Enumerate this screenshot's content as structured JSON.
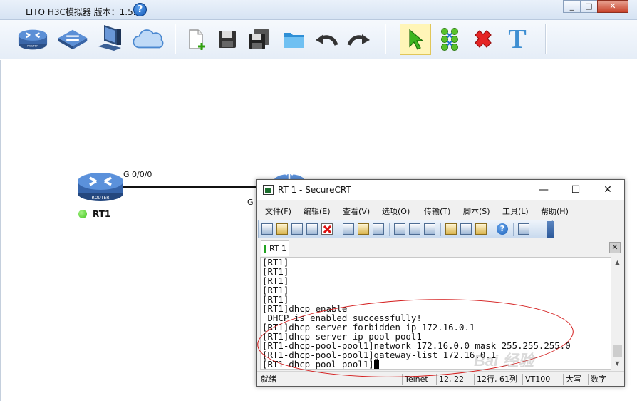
{
  "app": {
    "title": "LITO H3C模拟器 版本：1.5.2",
    "help_icon": "?",
    "window_controls": [
      "_",
      "□",
      "✕"
    ]
  },
  "toolbar": {
    "items": [
      "router-icon",
      "switch-icon",
      "pc-icon",
      "cloud-icon",
      "new-file-icon",
      "save-icon",
      "save-as-icon",
      "open-folder-icon",
      "undo-icon",
      "redo-icon",
      "select-pointer-icon",
      "link-tool-icon",
      "delete-icon",
      "text-tool-icon"
    ],
    "text_tool_label": "T",
    "active_item": "select-pointer-icon"
  },
  "topology": {
    "router1": {
      "name": "RT1",
      "badge": "ROUTER",
      "port": "G 0/0/0",
      "status_color": "#3ec11a"
    },
    "router2": {
      "port_label_partial": "G"
    }
  },
  "crt": {
    "title": "RT 1 - SecureCRT",
    "controls": [
      "—",
      "☐",
      "✕"
    ],
    "menu": [
      "文件(F)",
      "编辑(E)",
      "查看(V)",
      "选项(O)",
      "传输(T)",
      "脚本(S)",
      "工具(L)",
      "帮助(H)"
    ],
    "tab": {
      "label": "RT 1",
      "close": "✕"
    },
    "terminal_lines": [
      "[RT1]",
      "[RT1]",
      "[RT1]",
      "[RT1]",
      "[RT1]",
      "[RT1]dhcp enable",
      " DHCP is enabled successfully!",
      "[RT1]dhcp server forbidden-ip 172.16.0.1",
      "[RT1]dhcp server ip-pool pool1",
      "[RT1-dhcp-pool-pool1]network 172.16.0.0 mask 255.255.255.0",
      "[RT1-dhcp-pool-pool1]gateway-list 172.16.0.1",
      "[RT1-dhcp-pool-pool1]"
    ],
    "status": {
      "ready": "就绪",
      "protocol": "Telnet",
      "cursor_pos": "12,  22",
      "row_col": "12行, 61列",
      "term_type": "VT100",
      "caps": "大写",
      "num": "数字"
    },
    "annotation_color": "#d41b1b"
  },
  "watermark": "Bai 经验"
}
